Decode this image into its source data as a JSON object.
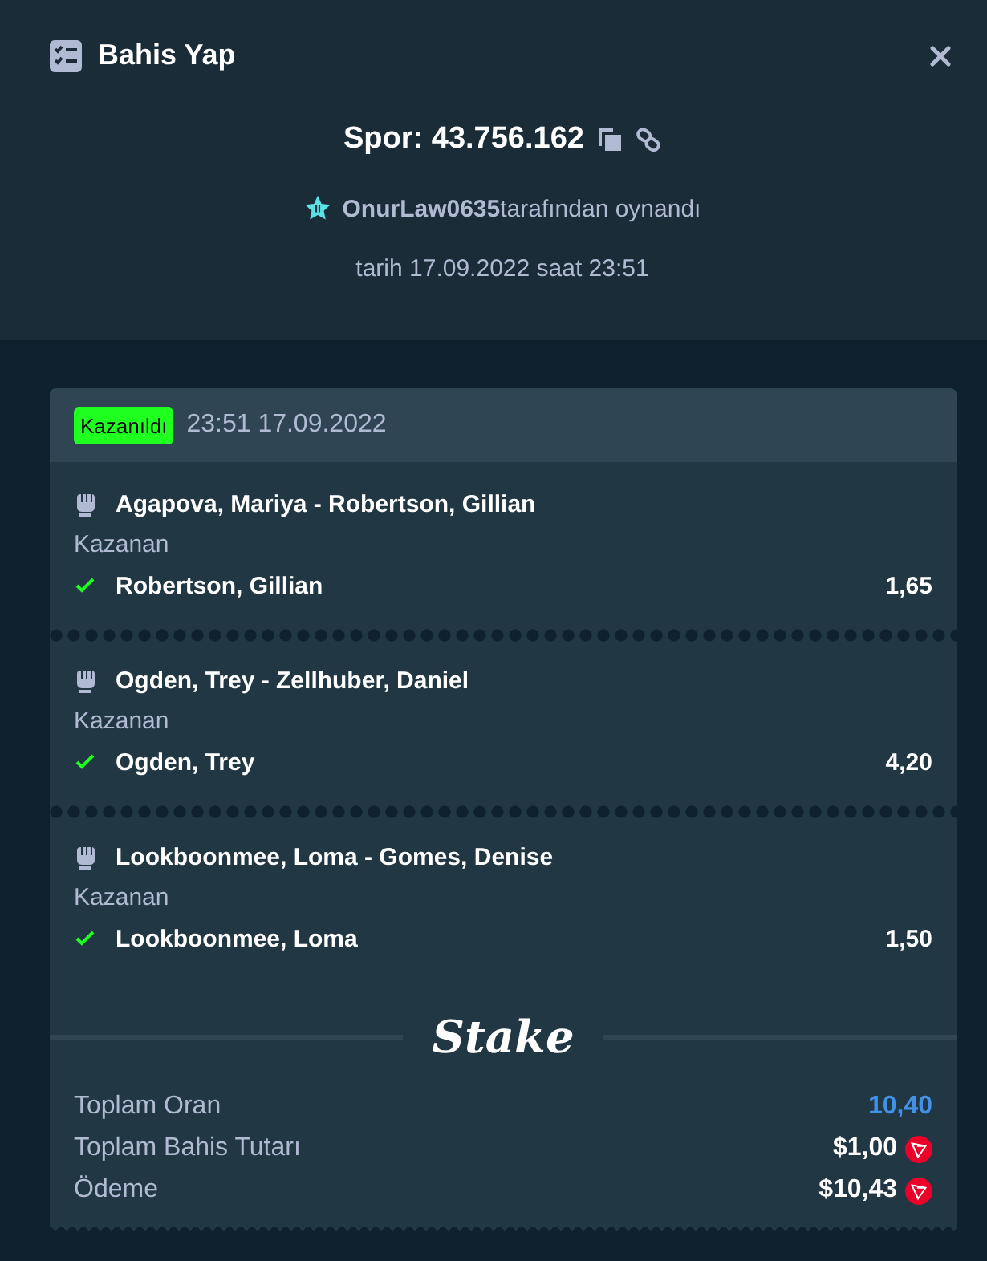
{
  "dialog": {
    "title": "Bahis Yap"
  },
  "bet": {
    "label": "Spor: 43.756.162",
    "user": "OnurLaw0635",
    "played_by": "tarafından oynandı",
    "date_line": "tarih 17.09.2022 saat 23:51"
  },
  "slip": {
    "status": {
      "label": "Kazanıldı",
      "kind": "won"
    },
    "time": "23:51 17.09.2022",
    "legs": [
      {
        "event": "Agapova, Mariya - Robertson, Gillian",
        "market": "Kazanan",
        "pick": "Robertson, Gillian",
        "odds": "1,65",
        "won": true
      },
      {
        "event": "Ogden, Trey - Zellhuber, Daniel",
        "market": "Kazanan",
        "pick": "Ogden, Trey",
        "odds": "4,20",
        "won": true
      },
      {
        "event": "Lookboonmee, Loma - Gomes, Denise",
        "market": "Kazanan",
        "pick": "Lookboonmee, Loma",
        "odds": "1,50",
        "won": true
      }
    ],
    "logo": "Stake",
    "summary": [
      {
        "label": "Toplam Oran",
        "value": "10,40",
        "kind": "odds"
      },
      {
        "label": "Toplam Bahis Tutarı",
        "value": "$1,00",
        "kind": "amount"
      },
      {
        "label": "Ödeme",
        "value": "$10,43",
        "kind": "amount"
      }
    ]
  }
}
